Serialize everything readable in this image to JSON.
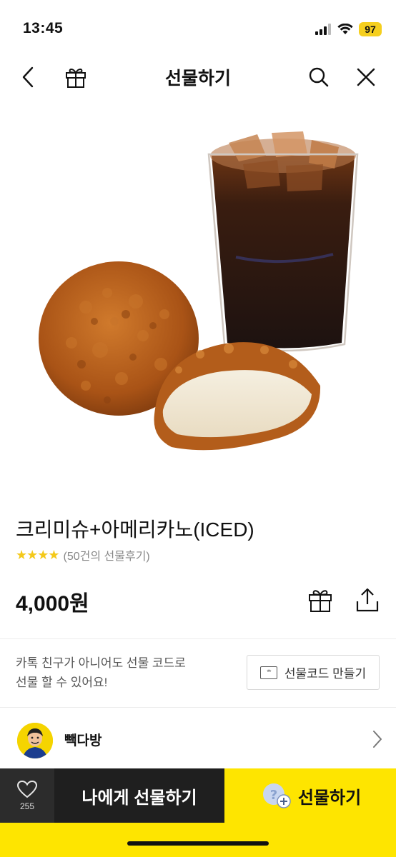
{
  "status_bar": {
    "time": "13:45",
    "battery": "97"
  },
  "nav": {
    "title": "선물하기",
    "back_icon": "chevron-left-icon",
    "gift_icon": "gift-icon",
    "search_icon": "search-icon",
    "close_icon": "close-icon"
  },
  "product": {
    "name": "크리미슈+아메리카노(ICED)",
    "stars": "★★★★",
    "review_count": "(50건의 선물후기)",
    "price": "4,000원"
  },
  "gift_code": {
    "description_line1": "카톡 친구가 아니어도 선물 코드로",
    "description_line2": "선물 할 수 있어요!",
    "button_label": "선물코드 만들기",
    "icon_text": "**"
  },
  "brand": {
    "name": "빽다방"
  },
  "bottom_bar": {
    "wish_count": "255",
    "self_gift_label": "나에게 선물하기",
    "gift_label": "선물하기"
  },
  "colors": {
    "kakao_yellow": "#fee500",
    "dark": "#1f1f1f",
    "star": "#f4c91a"
  }
}
